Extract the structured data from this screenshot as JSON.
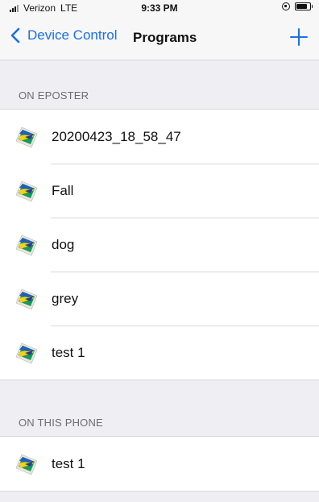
{
  "status_bar": {
    "carrier": "Verizon",
    "network": "LTE",
    "time": "9:33 PM",
    "battery_level": 0.85
  },
  "nav": {
    "back_label": "Device Control",
    "title": "Programs",
    "add_icon": "plus-icon",
    "back_icon": "chevron-left-icon"
  },
  "sections": {
    "on_eposter": {
      "header": "ON EPOSTER",
      "items": [
        {
          "label": "20200423_18_58_47",
          "icon": "program-image-icon"
        },
        {
          "label": "Fall",
          "icon": "program-image-icon"
        },
        {
          "label": "dog",
          "icon": "program-image-icon"
        },
        {
          "label": "grey",
          "icon": "program-image-icon"
        },
        {
          "label": "test 1",
          "icon": "program-image-icon"
        }
      ]
    },
    "on_this_phone": {
      "header": "ON THIS PHONE",
      "items": [
        {
          "label": "test 1",
          "icon": "program-image-icon"
        }
      ]
    }
  },
  "colors": {
    "accent": "#1a6fe8",
    "background": "#efeff3",
    "separator": "#d8d8dc",
    "section_text": "#6d6d72"
  }
}
